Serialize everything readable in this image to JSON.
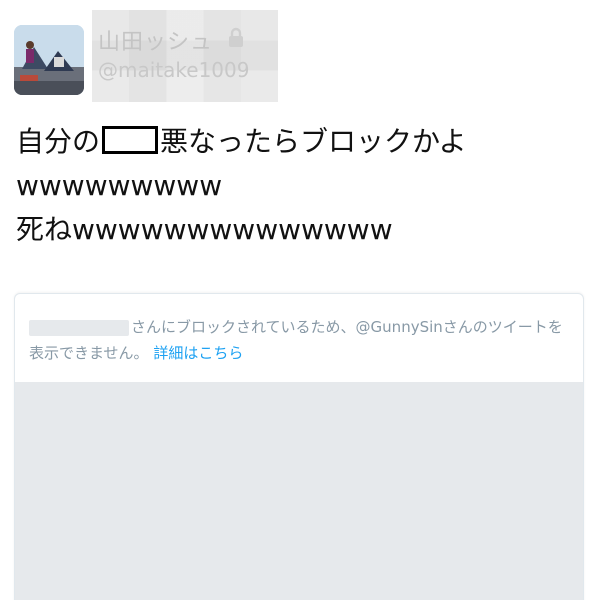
{
  "header": {
    "display_name": "山田ッシュ",
    "handle": "@maitake1009",
    "lock_icon": "lock-icon"
  },
  "tweet": {
    "line1_before": "自分の",
    "line1_after": "悪なったらブロックかよ",
    "line2": "wwwwwwwww",
    "line3": "死ねwwwwwwwwwwwwww"
  },
  "quote_card": {
    "notice_text": "さんにブロックされているため、@GunnySinさんのツイートを表示できません。",
    "link_text": "詳細はこちら"
  },
  "colors": {
    "link": "#1da1f2",
    "muted": "#8899a6",
    "placeholder_gray": "#e6e9ec"
  }
}
